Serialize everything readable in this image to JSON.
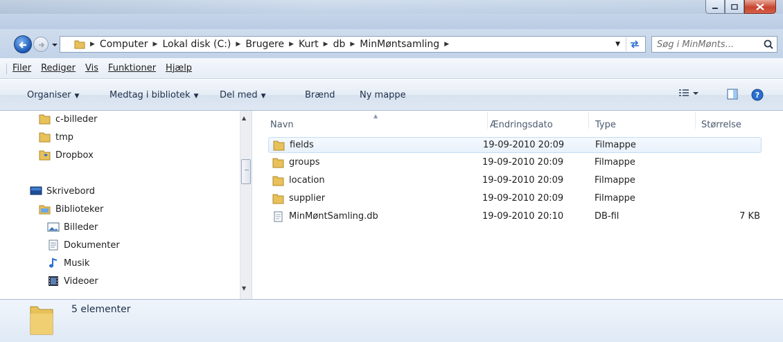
{
  "address": {
    "crumbs": [
      "Computer",
      "Lokal disk (C:)",
      "Brugere",
      "Kurt",
      "db",
      "MinMøntsamling"
    ]
  },
  "search": {
    "placeholder": "Søg i MinMønts..."
  },
  "menu": [
    "Filer",
    "Rediger",
    "Vis",
    "Funktioner",
    "Hjælp"
  ],
  "commands": {
    "organise": "Organiser",
    "include_library": "Medtag i bibliotek",
    "share_with": "Del med",
    "burn": "Brænd",
    "new_folder": "Ny mappe"
  },
  "nav_items": [
    {
      "label": "c-billeder",
      "icon": "folder-icon"
    },
    {
      "label": "tmp",
      "icon": "folder-icon"
    },
    {
      "label": "Dropbox",
      "icon": "dropbox-folder-icon"
    },
    {
      "label": "Skrivebord",
      "icon": "desktop-icon"
    },
    {
      "label": "Biblioteker",
      "icon": "libraries-icon"
    },
    {
      "label": "Billeder",
      "icon": "pictures-icon"
    },
    {
      "label": "Dokumenter",
      "icon": "documents-icon"
    },
    {
      "label": "Musik",
      "icon": "music-icon"
    },
    {
      "label": "Videoer",
      "icon": "videos-icon"
    }
  ],
  "columns": {
    "name": "Navn",
    "date": "Ændringsdato",
    "type": "Type",
    "size": "Størrelse"
  },
  "files": [
    {
      "name": "fields",
      "date": "19-09-2010 20:09",
      "type": "Filmappe",
      "size": "",
      "icon": "folder-icon"
    },
    {
      "name": "groups",
      "date": "19-09-2010 20:09",
      "type": "Filmappe",
      "size": "",
      "icon": "folder-icon"
    },
    {
      "name": "location",
      "date": "19-09-2010 20:09",
      "type": "Filmappe",
      "size": "",
      "icon": "folder-icon"
    },
    {
      "name": "supplier",
      "date": "19-09-2010 20:09",
      "type": "Filmappe",
      "size": "",
      "icon": "folder-icon"
    },
    {
      "name": "MinMøntSamling.db",
      "date": "19-09-2010 20:10",
      "type": "DB-fil",
      "size": "7 KB",
      "icon": "file-icon"
    }
  ],
  "status": {
    "count_text": "5 elementer"
  },
  "colors": {
    "accent": "#1a58b6",
    "folder": "#e8c15a",
    "selection": "#e8f1fb"
  }
}
